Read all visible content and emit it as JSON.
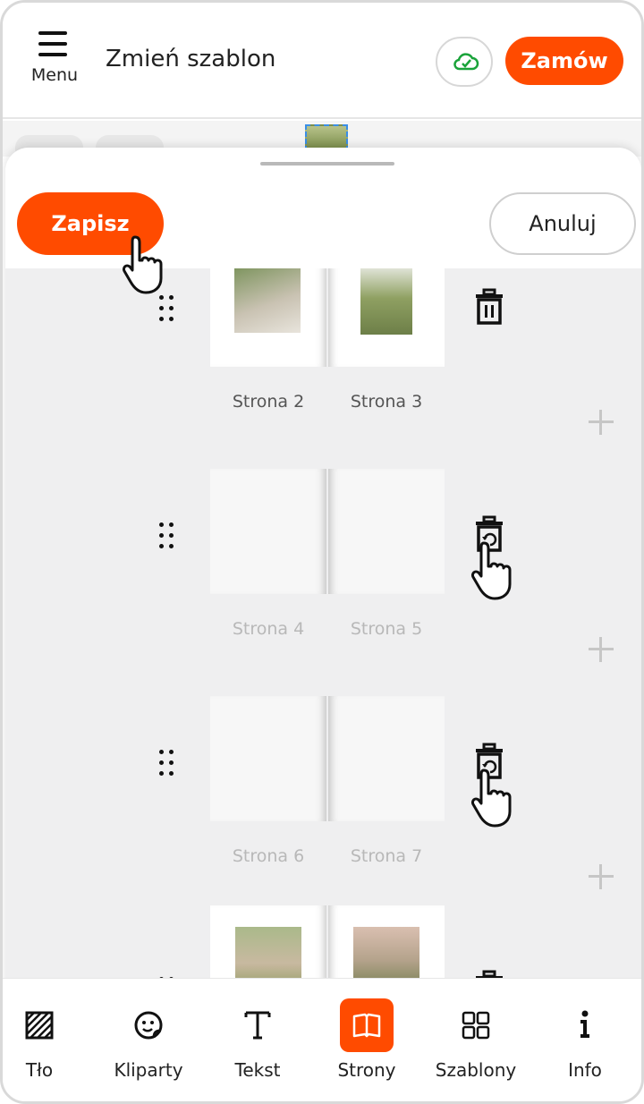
{
  "header": {
    "menu_label": "Menu",
    "title": "Zmień szablon",
    "order_label": "Zamów",
    "cloud_icon": "cloud-check-icon"
  },
  "sheet": {
    "save_label": "Zapisz",
    "cancel_label": "Anuluj"
  },
  "spreads": [
    {
      "left_label": "Strona 2",
      "right_label": "Strona 3",
      "state": "active"
    },
    {
      "left_label": "Strona 4",
      "right_label": "Strona 5",
      "state": "deleted"
    },
    {
      "left_label": "Strona 6",
      "right_label": "Strona 7",
      "state": "deleted"
    },
    {
      "left_label": "",
      "right_label": "",
      "state": "active"
    }
  ],
  "bottom_nav": {
    "items": [
      {
        "label": "Tło",
        "icon": "background-pattern-icon"
      },
      {
        "label": "Kliparty",
        "icon": "sticker-icon"
      },
      {
        "label": "Tekst",
        "icon": "text-icon"
      },
      {
        "label": "Strony",
        "icon": "pages-book-icon"
      },
      {
        "label": "Szablony",
        "icon": "templates-grid-icon"
      },
      {
        "label": "Info",
        "icon": "info-icon"
      }
    ]
  },
  "colors": {
    "accent": "#ff4b00",
    "label_active": "#555555",
    "label_deleted": "#b8b8b8"
  }
}
